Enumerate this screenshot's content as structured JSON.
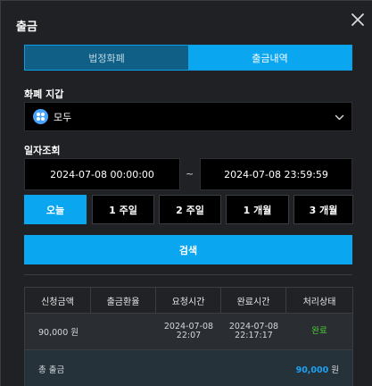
{
  "title": "출금",
  "tabs": [
    {
      "label": "법정화폐",
      "active": false
    },
    {
      "label": "출금내역",
      "active": true
    }
  ],
  "wallet": {
    "label": "화폐 지갑",
    "selected": "모두",
    "icon": "coin-icon"
  },
  "date_query": {
    "label": "일자조회",
    "start": "2024-07-08 00:00:00",
    "separator": "~",
    "end": "2024-07-08 23:59:59"
  },
  "ranges": [
    {
      "label": "오늘",
      "active": true
    },
    {
      "label": "1 주일",
      "active": false
    },
    {
      "label": "2 주일",
      "active": false
    },
    {
      "label": "1 개월",
      "active": false
    },
    {
      "label": "3 개월",
      "active": false
    }
  ],
  "search_label": "검색",
  "table": {
    "headers": [
      "신청금액",
      "출금환율",
      "요청시간",
      "완료시간",
      "처리상태"
    ],
    "rows": [
      {
        "amount": "90,000 원",
        "rate": "",
        "requested_date": "2024-07-08",
        "requested_time": "22:07",
        "completed_date": "2024-07-08",
        "completed_time": "22:17:17",
        "status": "완료"
      }
    ],
    "total": {
      "label": "총 출금",
      "value": "90,000",
      "unit": "원"
    }
  },
  "colors": {
    "accent": "#0aa6f0",
    "status_complete": "#4cd137",
    "background": "#1f2124"
  }
}
